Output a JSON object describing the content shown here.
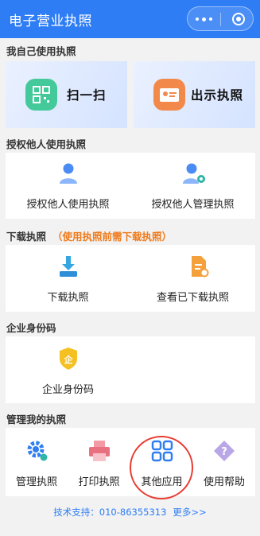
{
  "titlebar": {
    "title": "电子营业执照"
  },
  "sections": {
    "self": "我自己使用执照",
    "authorize": "授权他人使用执照",
    "download": "下载执照",
    "download_note": "（使用执照前需下载执照）",
    "company_code": "企业身份码",
    "manage": "管理我的执照"
  },
  "self_actions": {
    "scan": "扫一扫",
    "show": "出示执照"
  },
  "authorize_actions": {
    "use": "授权他人使用执照",
    "manage": "授权他人管理执照"
  },
  "download_actions": {
    "download": "下载执照",
    "view": "查看已下载执照"
  },
  "company_actions": {
    "code": "企业身份码"
  },
  "manage_actions": {
    "manage": "管理执照",
    "print": "打印执照",
    "other": "其他应用",
    "help": "使用帮助"
  },
  "footer": {
    "label": "技术支持：",
    "phone": "010-86355313",
    "more": "更多>>"
  },
  "colors": {
    "accent": "#2e7df5",
    "note": "#f07a1a",
    "highlight": "#e83b30"
  },
  "icons": [
    "more-dots-icon",
    "target-icon",
    "qr-scan-icon",
    "license-card-icon",
    "authorize-person-icon",
    "manage-person-icon",
    "download-icon",
    "document-view-icon",
    "shield-company-icon",
    "gear-icon",
    "printer-icon",
    "apps-grid-icon",
    "help-icon"
  ]
}
